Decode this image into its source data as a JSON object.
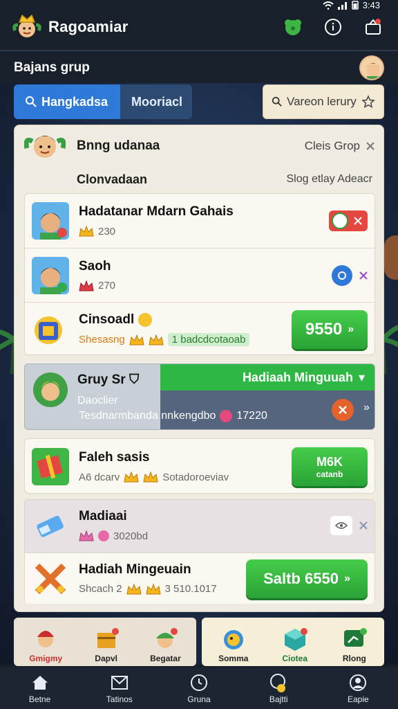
{
  "status_bar": {
    "time": "3:43"
  },
  "app": {
    "title": "Ragoamiar"
  },
  "section": {
    "title": "Bajans grup"
  },
  "tabs": [
    {
      "label": "Hangkadsa",
      "active": true
    },
    {
      "label": "Mooriacl",
      "active": false
    }
  ],
  "search": {
    "placeholder": "Vareon lerury"
  },
  "group": {
    "title": "Bnng udanaa",
    "action": "Cleis Grop",
    "sub_label": "Clonvadaan",
    "sub_right": "Slog etlay Adeacr"
  },
  "members": [
    {
      "name": "Hadatanar Mdarn Gahais",
      "score": "230"
    },
    {
      "name": "Saoh",
      "score": "270"
    },
    {
      "name": "Cinsoadl",
      "meta": "Shesasng",
      "progress_label": "1 badcdcotaoab",
      "button": "9550"
    }
  ],
  "grup_card": {
    "name": "Gruy Sr",
    "desc": "Daoclier",
    "banner": "Hadiaah Minguuah",
    "stat_text": "Tesdnarmbanda nnkengdbo",
    "stat_value": "17220"
  },
  "items": [
    {
      "name": "Faleh sasis",
      "meta": "A6 dcarv",
      "meta2": "Sotadoroeviav",
      "btn_top": "M6K",
      "btn_bottom": "catanb"
    },
    {
      "name": "Madiaai",
      "meta": "3020bd"
    },
    {
      "name": "Hadiah Mingeuain",
      "meta": "Shcach 2",
      "meta2": "3 510.1017",
      "button": "Saltb 6550"
    }
  ],
  "dock_left": [
    {
      "label": "Gmigmy"
    },
    {
      "label": "Dapvl"
    },
    {
      "label": "Begatar"
    }
  ],
  "dock_right": [
    {
      "label": "Somma"
    },
    {
      "label": "Ciotea"
    },
    {
      "label": "Rlong"
    }
  ],
  "nav": [
    {
      "label": "Betne"
    },
    {
      "label": "Tatinos"
    },
    {
      "label": "Gruna"
    },
    {
      "label": "Bajtti"
    },
    {
      "label": "Eapie"
    }
  ],
  "colors": {
    "accent": "#2f7ad9",
    "green": "#2fb844",
    "red": "#e4473f",
    "orange": "#e5622c"
  }
}
